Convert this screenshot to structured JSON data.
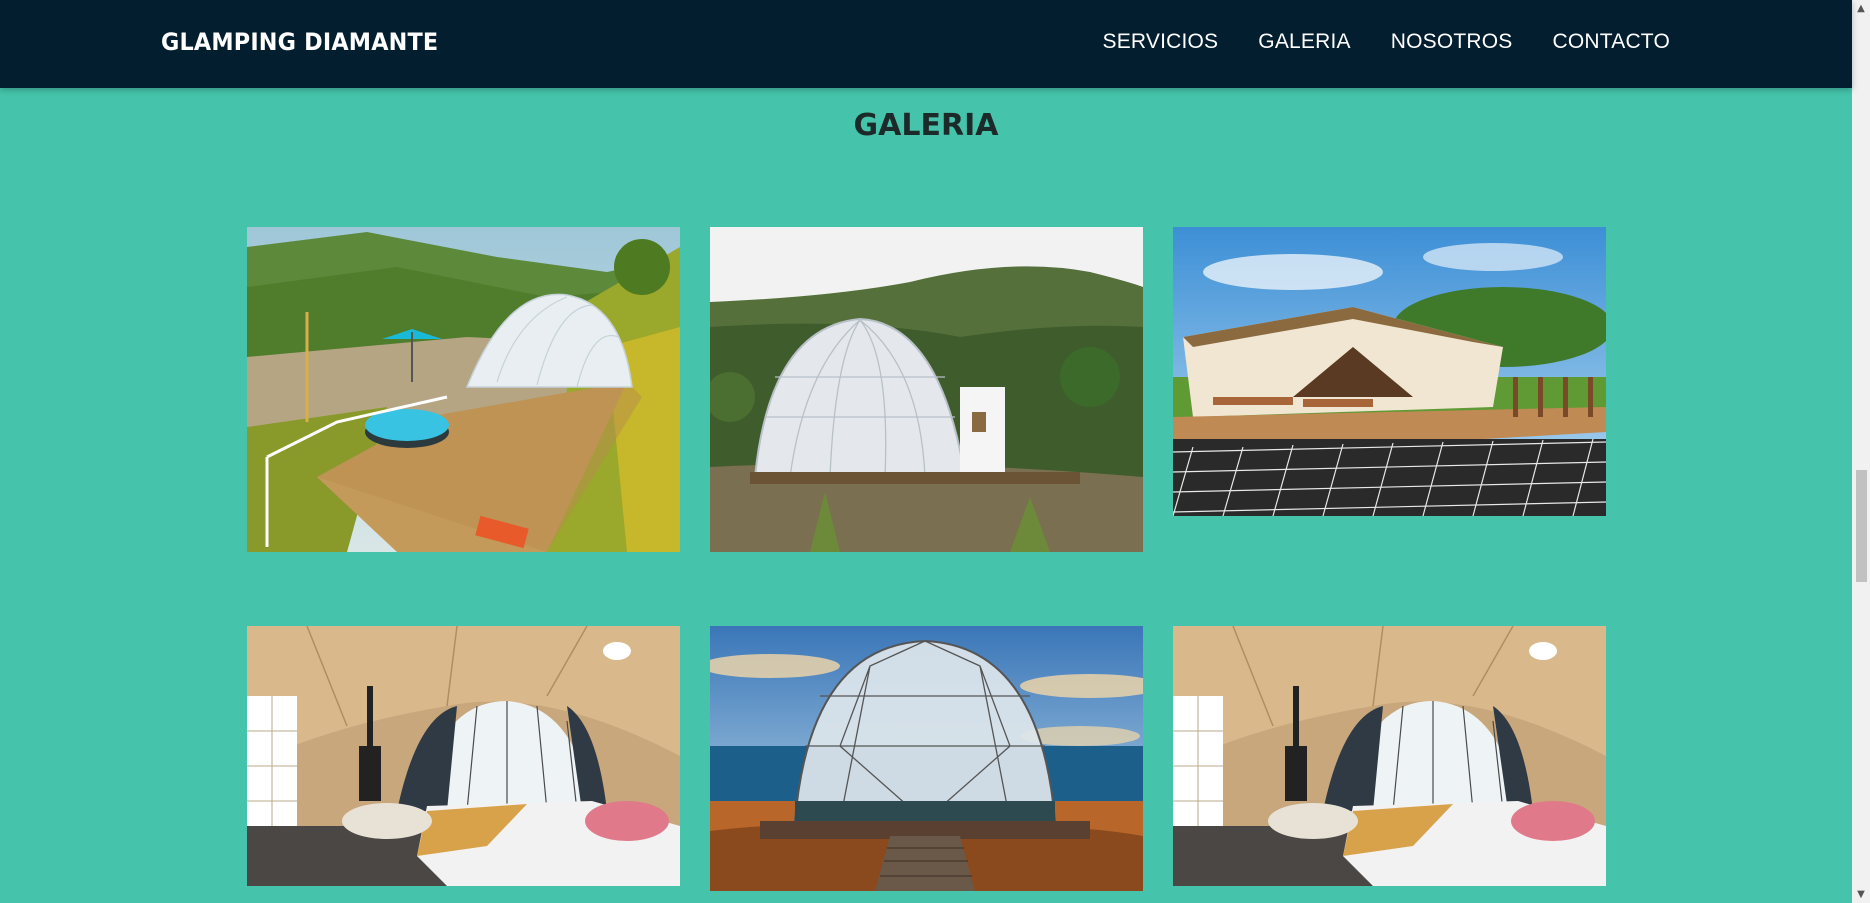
{
  "header": {
    "brand": "GLAMPING DIAMANTE",
    "nav": [
      "SERVICIOS",
      "GALERIA",
      "NOSOTROS",
      "CONTACTO"
    ]
  },
  "main": {
    "title": "GALERIA",
    "photos": [
      "dome-deck-hot-tub-mountain",
      "dome-forest-hill",
      "safari-tent-net-deck",
      "dome-interior-bedroom",
      "dome-beach-sunset",
      "dome-interior-bedroom"
    ]
  },
  "colors": {
    "background": "#45c4ab",
    "navbar": "#031e2e",
    "title": "#1d2a2a"
  },
  "scrollbar": {
    "up_icon": "chevron-up-icon",
    "down_icon": "chevron-down-icon"
  }
}
